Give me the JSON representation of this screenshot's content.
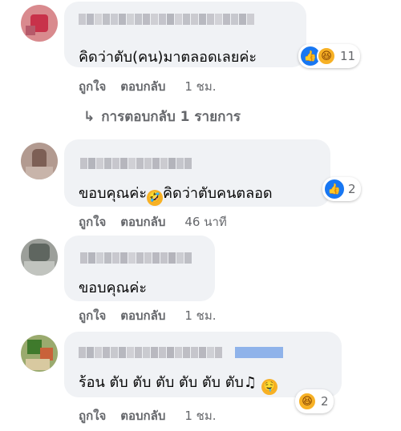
{
  "comments": [
    {
      "text": "คิดว่าตับ(คน)มาตลอดเลยค่ะ",
      "reactions": {
        "icons": [
          "like-icon",
          "haha-icon"
        ],
        "count": "11"
      },
      "actions": {
        "like": "ถูกใจ",
        "reply": "ตอบกลับ",
        "time": "1 ชม."
      },
      "replies": "การตอบกลับ 1 รายการ"
    },
    {
      "text_before_emoji": "ขอบคุณค่ะ",
      "inline_emoji": "rolling-laugh-emoji",
      "text_after_emoji": "คิดว่าตับคนตลอด",
      "reactions": {
        "icons": [
          "like-icon"
        ],
        "count": "2"
      },
      "actions": {
        "like": "ถูกใจ",
        "reply": "ตอบกลับ",
        "time": "46 นาที"
      }
    },
    {
      "text": "ขอบคุณค่ะ",
      "actions": {
        "like": "ถูกใจ",
        "reply": "ตอบกลับ",
        "time": "1 ชม."
      }
    },
    {
      "text": "ร้อน ตับ ตับ ตับ ตับ ตับ ตับ",
      "trailing_icons": [
        "music-note-icon",
        "drooling-emoji"
      ],
      "reactions": {
        "icons": [
          "haha-icon"
        ],
        "count": "2"
      },
      "actions": {
        "like": "ถูกใจ",
        "reply": "ตอบกลับ",
        "time": "1 ชม."
      }
    }
  ],
  "colors": {
    "bubble": "#f0f2f5",
    "meta": "#65676b",
    "like": "#1877f2",
    "haha": "#f7b125"
  }
}
